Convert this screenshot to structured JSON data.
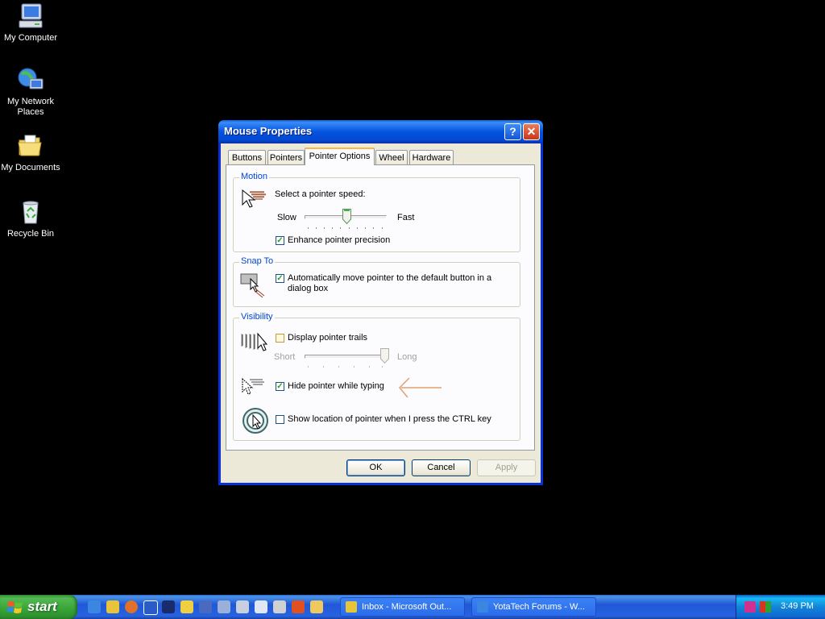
{
  "desktop": {
    "icons": [
      {
        "label": "My Computer"
      },
      {
        "label": "My Network Places"
      },
      {
        "label": "My Documents"
      },
      {
        "label": "Recycle Bin"
      }
    ]
  },
  "window": {
    "title": "Mouse Properties",
    "help_glyph": "?",
    "close_glyph": "✕",
    "tabs": [
      {
        "label": "Buttons"
      },
      {
        "label": "Pointers"
      },
      {
        "label": "Pointer Options",
        "active": true
      },
      {
        "label": "Wheel"
      },
      {
        "label": "Hardware"
      }
    ],
    "motion": {
      "title": "Motion",
      "speed_label": "Select a pointer speed:",
      "slow_label": "Slow",
      "fast_label": "Fast",
      "speed_level": 0.5,
      "enhance_label": "Enhance pointer precision",
      "enhance_checked": true
    },
    "snap_to": {
      "title": "Snap To",
      "auto_label_line1": "Automatically move pointer to the default button in a",
      "auto_label_line2": "dialog box",
      "auto_checked": true
    },
    "visibility": {
      "title": "Visibility",
      "trails_label": "Display pointer trails",
      "trails_checked": false,
      "short_label": "Short",
      "long_label": "Long",
      "trails_level": 1.0,
      "hide_label": "Hide pointer while typing",
      "hide_checked": true,
      "ctrl_label": "Show location of pointer when I press the CTRL key",
      "ctrl_checked": false
    },
    "buttons": {
      "ok": "OK",
      "cancel": "Cancel",
      "apply": "Apply"
    }
  },
  "taskbar": {
    "start_label": "start",
    "tasks": [
      {
        "label": "Inbox - Microsoft Out..."
      },
      {
        "label": "YotaTech Forums - W..."
      }
    ],
    "clock": "3:49 PM"
  },
  "colors": {
    "annotation_arrow": "#e0a070",
    "checkmark": "#21a121",
    "group_title": "#0046d5"
  }
}
